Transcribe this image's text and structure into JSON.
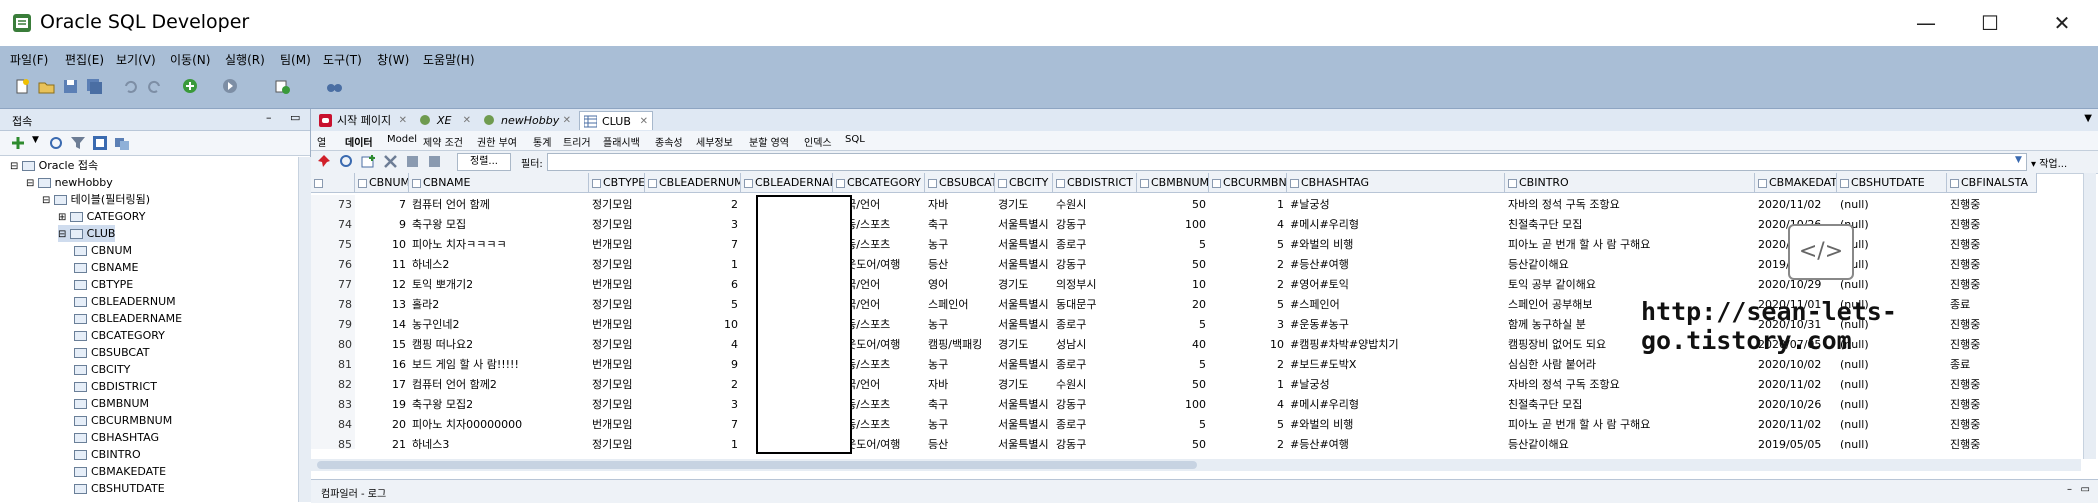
{
  "app": {
    "title": "Oracle SQL Developer",
    "window_controls": {
      "minimize": "—",
      "maximize": "☐",
      "close": "✕"
    }
  },
  "menu": [
    "파일(F)",
    "편집(E)",
    "보기(V)",
    "이동(N)",
    "실행(R)",
    "팀(M)",
    "도구(T)",
    "창(W)",
    "도움말(H)"
  ],
  "left_panel": {
    "title": "접속",
    "tree": [
      {
        "label": "Oracle 접속",
        "level": 0,
        "icon": "connection-folder-icon"
      },
      {
        "label": "newHobby",
        "level": 1,
        "icon": "database-icon"
      },
      {
        "label": "테이블(필터링됨)",
        "level": 2,
        "icon": "tables-folder-icon"
      },
      {
        "label": "CATEGORY",
        "level": 3,
        "icon": "table-icon"
      },
      {
        "label": "CLUB",
        "level": 3,
        "icon": "table-icon",
        "selected": true
      },
      {
        "label": "CBNUM",
        "level": 4,
        "icon": "column-icon"
      },
      {
        "label": "CBNAME",
        "level": 4,
        "icon": "column-icon"
      },
      {
        "label": "CBTYPE",
        "level": 4,
        "icon": "column-icon"
      },
      {
        "label": "CBLEADERNUM",
        "level": 4,
        "icon": "column-icon"
      },
      {
        "label": "CBLEADERNAME",
        "level": 4,
        "icon": "column-icon"
      },
      {
        "label": "CBCATEGORY",
        "level": 4,
        "icon": "column-icon"
      },
      {
        "label": "CBSUBCAT",
        "level": 4,
        "icon": "column-icon"
      },
      {
        "label": "CBCITY",
        "level": 4,
        "icon": "column-icon"
      },
      {
        "label": "CBDISTRICT",
        "level": 4,
        "icon": "column-icon"
      },
      {
        "label": "CBMBNUM",
        "level": 4,
        "icon": "column-icon"
      },
      {
        "label": "CBCURMBNUM",
        "level": 4,
        "icon": "column-icon"
      },
      {
        "label": "CBHASHTAG",
        "level": 4,
        "icon": "column-icon"
      },
      {
        "label": "CBINTRO",
        "level": 4,
        "icon": "column-icon"
      },
      {
        "label": "CBMAKEDATE",
        "level": 4,
        "icon": "column-icon"
      },
      {
        "label": "CBSHUTDATE",
        "level": 4,
        "icon": "column-icon"
      }
    ]
  },
  "doc_tabs": [
    {
      "label": "시작 페이지",
      "icon": "start-page-icon",
      "active": false
    },
    {
      "label": "XE",
      "icon": "connection-icon",
      "active": false
    },
    {
      "label": "newHobby",
      "icon": "connection-icon",
      "active": false
    },
    {
      "label": "CLUB",
      "icon": "table-icon",
      "active": true
    }
  ],
  "sub_tabs": [
    "열",
    "데이터",
    "Model",
    "제약 조건",
    "권한 부여",
    "통계",
    "트리거",
    "플래시백",
    "종속성",
    "세부정보",
    "분할 영역",
    "인덱스",
    "SQL"
  ],
  "grid_toolbar": {
    "sort_label": "정렬...",
    "filter_label": "필터:",
    "actions_label": "작업..."
  },
  "columns": [
    "CBNUM",
    "CBNAME",
    "CBTYPE",
    "CBLEADERNUM",
    "CBLEADERNAME",
    "CBCATEGORY",
    "CBSUBCAT",
    "CBCITY",
    "CBDISTRICT",
    "CBMBNUM",
    "CBCURMBNUM",
    "CBHASHTAG",
    "CBINTRO",
    "CBMAKEDATE",
    "CBSHUTDATE",
    "CBFINALSTA"
  ],
  "rows": [
    [
      "73",
      "7",
      "컴퓨터 언어 함께",
      "정기모임",
      "2",
      "",
      "외국/언어",
      "자바",
      "경기도",
      "수원시",
      "50",
      "1",
      "#날궁성",
      "자바의 정석 구독 조항요",
      "2020/11/02",
      "(null)",
      "진행중"
    ],
    [
      "74",
      "9",
      "축구왕 모집",
      "정기모임",
      "3",
      "",
      "운동/스포츠",
      "축구",
      "서울특별시",
      "강동구",
      "100",
      "4",
      "#메시#우리형",
      "친절축구단 모집",
      "2020/10/26",
      "(null)",
      "진행중"
    ],
    [
      "75",
      "10",
      "피아노 치자ㅋㅋㅋㅋ",
      "번개모임",
      "7",
      "",
      "운동/스포츠",
      "농구",
      "서울특별시",
      "종로구",
      "5",
      "5",
      "#와벌의 비행",
      "피아노 곧 번개 할 사 람 구해요",
      "2020/11/02",
      "(null)",
      "진행중"
    ],
    [
      "76",
      "11",
      "하네스2",
      "정기모임",
      "1",
      "",
      "아웃도어/여행",
      "등산",
      "서울특별시",
      "강동구",
      "50",
      "2",
      "#등산#여행",
      "등산같이해요",
      "2019/05/05",
      "(null)",
      "진행중"
    ],
    [
      "77",
      "12",
      "토익 뽀개기2",
      "번개모임",
      "6",
      "",
      "외국/언어",
      "영어",
      "경기도",
      "의정부시",
      "10",
      "2",
      "#영어#토익",
      "토익 공부 같이해요",
      "2020/10/29",
      "(null)",
      "진행중"
    ],
    [
      "78",
      "13",
      "홀라2",
      "정기모임",
      "5",
      "",
      "외국/언어",
      "스페인어",
      "서울특별시",
      "동대문구",
      "20",
      "5",
      "#스페인어",
      "스페인어 공부해보",
      "2020/11/01",
      "(null)",
      "종료"
    ],
    [
      "79",
      "14",
      "농구인네2",
      "번개모임",
      "10",
      "",
      "운동/스포츠",
      "농구",
      "서울특별시",
      "종로구",
      "5",
      "3",
      "#운동#농구",
      "함께 농구하실 분",
      "2020/10/31",
      "(null)",
      "진행중"
    ],
    [
      "80",
      "15",
      "캠핑 떠나요2",
      "정기모임",
      "4",
      "",
      "아웃도어/여행",
      "캠핑/백패킹",
      "경기도",
      "성남시",
      "40",
      "10",
      "#캠핑#차박#양밥치기",
      "캠핑장비 없어도 되요",
      "2020/07/05",
      "(null)",
      "진행중"
    ],
    [
      "81",
      "16",
      "보드 게임 할 사 람!!!!!",
      "번개모임",
      "9",
      "",
      "운동/스포츠",
      "농구",
      "서울특별시",
      "종로구",
      "5",
      "2",
      "#보드#도박X",
      "심심한 사람 붙어라",
      "2020/10/02",
      "(null)",
      "종료"
    ],
    [
      "82",
      "17",
      "컴퓨터 언어 함께2",
      "정기모임",
      "2",
      "",
      "외국/언어",
      "자바",
      "경기도",
      "수원시",
      "50",
      "1",
      "#날궁성",
      "자바의 정석 구독 조항요",
      "2020/11/02",
      "(null)",
      "진행중"
    ],
    [
      "83",
      "19",
      "축구왕 모집2",
      "정기모임",
      "3",
      "",
      "운동/스포츠",
      "축구",
      "서울특별시",
      "강동구",
      "100",
      "4",
      "#메시#우리형",
      "친절축구단 모집",
      "2020/10/26",
      "(null)",
      "진행중"
    ],
    [
      "84",
      "20",
      "피아노 치자00000000",
      "번개모임",
      "7",
      "",
      "운동/스포츠",
      "농구",
      "서울특별시",
      "종로구",
      "5",
      "5",
      "#와벌의 비행",
      "피아노 곧 번개 할 사 람 구해요",
      "2020/11/02",
      "(null)",
      "진행중"
    ],
    [
      "85",
      "21",
      "하네스3",
      "정기모임",
      "1",
      "",
      "아웃도어/여행",
      "등산",
      "서울특별시",
      "강동구",
      "50",
      "2",
      "#등산#여행",
      "등산같이해요",
      "2019/05/05",
      "(null)",
      "진행중"
    ]
  ],
  "bottom_log": "컴파일러 - 로그",
  "watermark": {
    "text": "http://sean-lets-go.tistory.com",
    "badge": "</>"
  }
}
